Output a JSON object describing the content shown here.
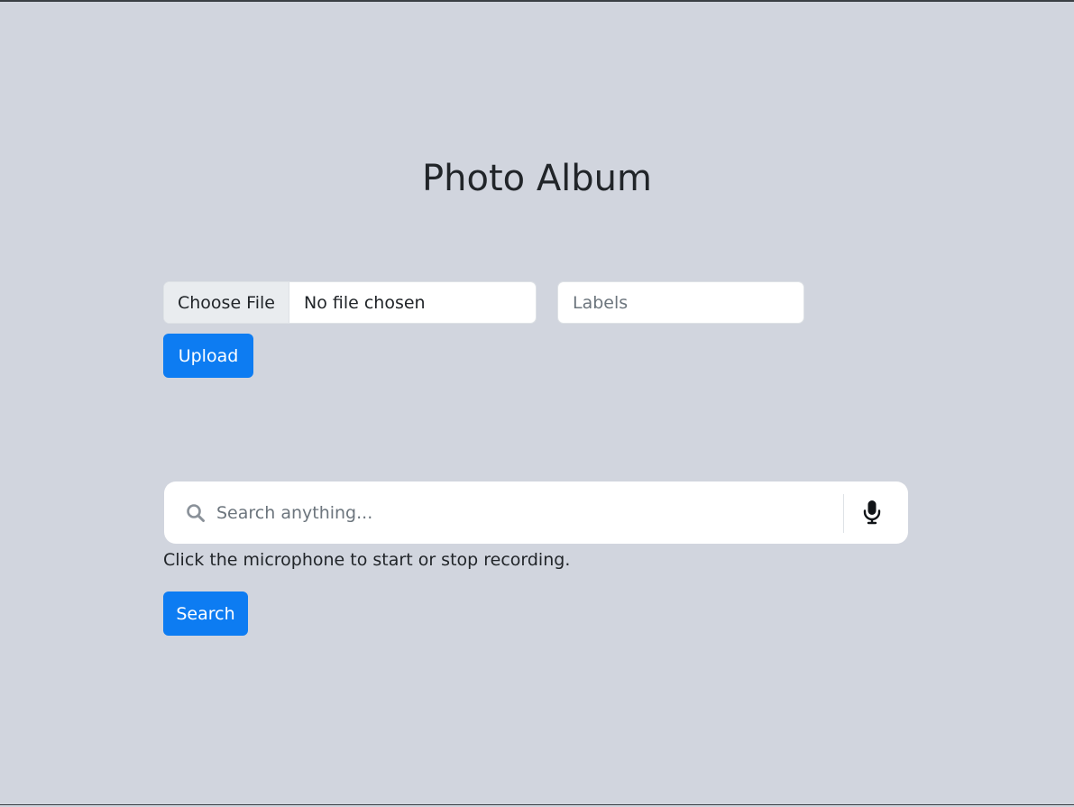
{
  "page": {
    "title": "Photo Album"
  },
  "upload": {
    "choose_file_label": "Choose File",
    "file_status": "No file chosen",
    "labels_placeholder": "Labels",
    "labels_value": "",
    "upload_label": "Upload"
  },
  "search": {
    "placeholder": "Search anything...",
    "value": "",
    "search_icon": "search-icon",
    "mic_icon": "microphone-icon",
    "hint": "Click the microphone to start or stop recording.",
    "search_label": "Search"
  },
  "colors": {
    "background": "#d1d5de",
    "primary_button": "#0d7cf2",
    "text": "#212529"
  }
}
